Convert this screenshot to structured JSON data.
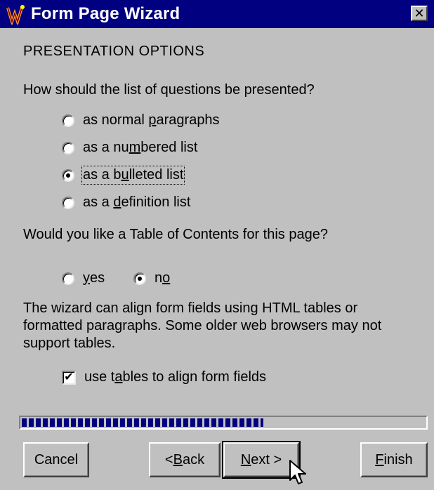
{
  "window": {
    "title": "Form Page Wizard",
    "close_glyph": "✕"
  },
  "section": {
    "heading": "PRESENTATION OPTIONS"
  },
  "question_list": {
    "prompt": "How should the list of questions be presented?",
    "options": [
      {
        "pre": "as normal ",
        "mn": "p",
        "post": "aragraphs",
        "selected": false
      },
      {
        "pre": "as a nu",
        "mn": "m",
        "post": "bered list",
        "selected": false
      },
      {
        "pre": "as a b",
        "mn": "u",
        "post": "lleted list",
        "selected": true
      },
      {
        "pre": "as a ",
        "mn": "d",
        "post": "efinition list",
        "selected": false
      }
    ]
  },
  "toc": {
    "prompt": "Would you like a Table of Contents for this page?",
    "yes": {
      "pre": "",
      "mn": "y",
      "post": "es",
      "selected": false
    },
    "no": {
      "pre": "n",
      "mn": "o",
      "post": "",
      "selected": true
    }
  },
  "tables": {
    "description": "The wizard can align form fields using HTML tables or formatted paragraphs. Some older web browsers may not support tables.",
    "checkbox": {
      "pre": "use t",
      "mn": "a",
      "post": "bles to align form fields",
      "checked": true,
      "check_glyph": "✔"
    }
  },
  "progress": {
    "fraction": 0.6
  },
  "buttons": {
    "cancel": "Cancel",
    "back": {
      "pre": "< ",
      "mn": "B",
      "post": "ack"
    },
    "next": {
      "pre": "",
      "mn": "N",
      "post": "ext >"
    },
    "finish": {
      "pre": "",
      "mn": "F",
      "post": "inish"
    }
  },
  "colors": {
    "title_bar": "#000080",
    "window_bg": "#c0c0c0",
    "progress_fill": "#000080"
  }
}
